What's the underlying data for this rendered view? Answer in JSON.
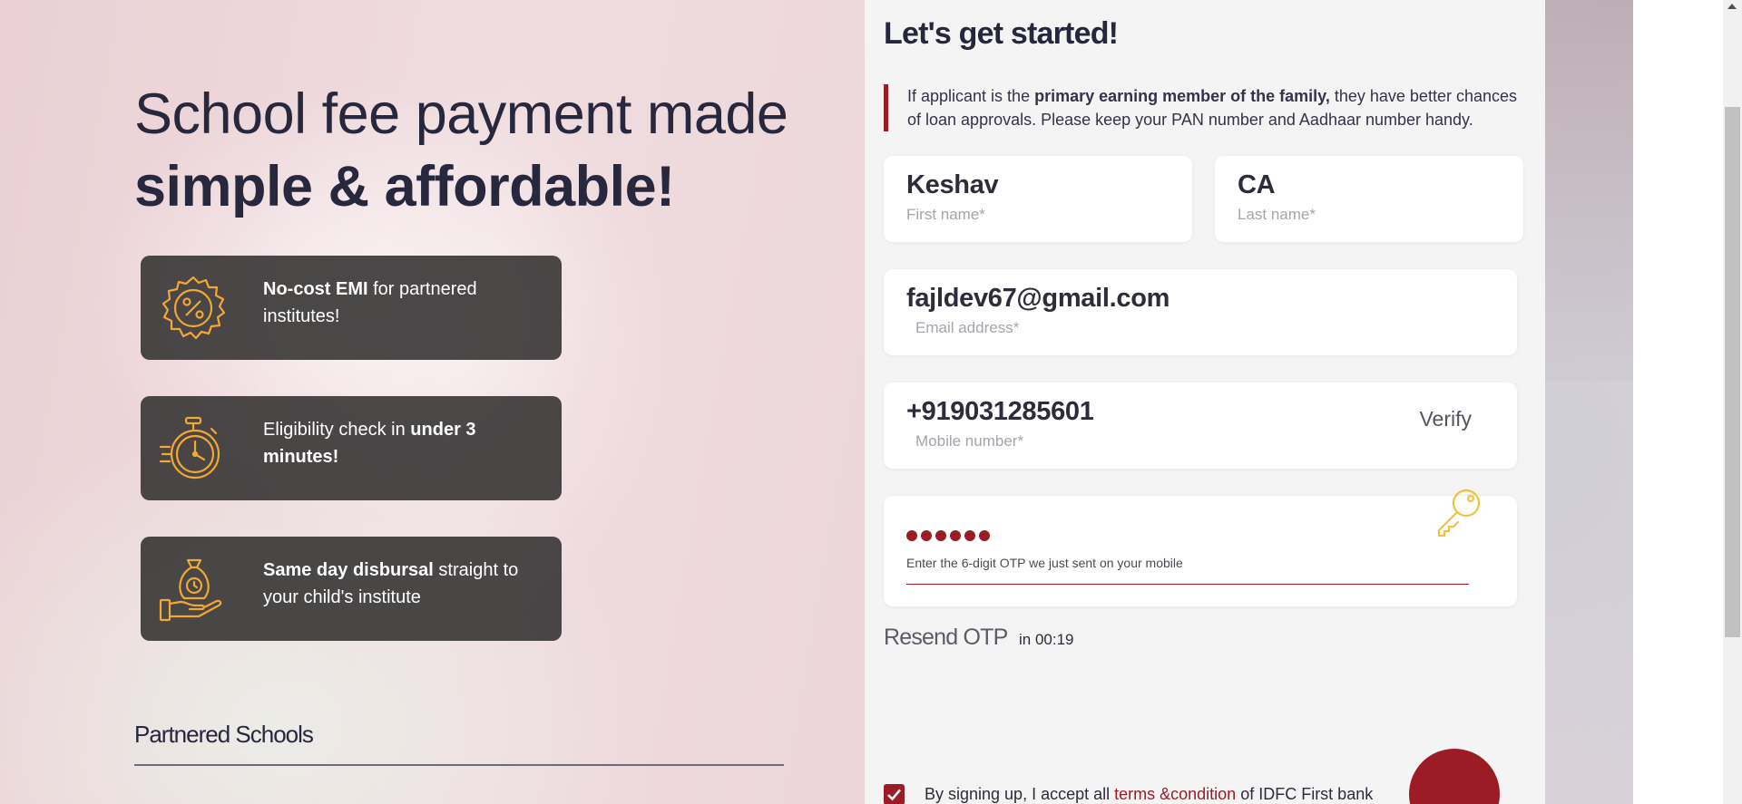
{
  "hero": {
    "title_line1": "School fee payment made",
    "title_line2": "simple & affordable!"
  },
  "features": [
    {
      "icon": "percent-badge-icon",
      "bold": "No-cost EMI",
      "text": " for partnered institutes!"
    },
    {
      "icon": "stopwatch-icon",
      "prefix": "Eligibility check in ",
      "bold": "under 3 minutes!"
    },
    {
      "icon": "money-bag-hand-icon",
      "bold": "Same day disbursal",
      "text": " straight to your child's institute"
    }
  ],
  "partners": {
    "title": "Partnered Schools"
  },
  "form": {
    "title": "Let's get started!",
    "notice": {
      "prefix": "If applicant is the ",
      "bold": "primary earning member of the family,",
      "suffix": " they have better chances of loan approvals. Please keep your PAN number and Aadhaar number handy."
    },
    "first_name": {
      "value": "Keshav",
      "label": "First name*"
    },
    "last_name": {
      "value": "CA",
      "label": "Last name*"
    },
    "email": {
      "value": "fajldev67@gmail.com",
      "label": "Email address*"
    },
    "mobile": {
      "value": "+919031285601",
      "label": "Mobile number*",
      "verify_label": "Verify"
    },
    "otp": {
      "masked_length": 6,
      "hint": "Enter the 6-digit OTP we just sent on your mobile",
      "icon": "key-icon"
    },
    "resend_label": "Resend OTP",
    "resend_timer": "in 00:19",
    "terms": {
      "prefix": "By signing up, I accept all ",
      "link": "terms &condition",
      "suffix": " of IDFC First bank",
      "checked": true
    }
  },
  "colors": {
    "accent": "#9b1c24",
    "feature_bg": "#323030",
    "icon_gold": "#f2a832",
    "panel_bg": "#f4f4f5"
  }
}
